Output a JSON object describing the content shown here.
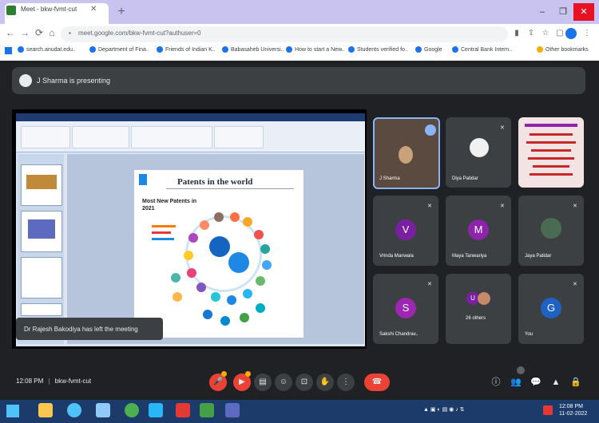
{
  "browser": {
    "tab_title": "Meet - bkw-fvmt-cut",
    "url": "meet.google.com/bkw-fvmt-cut?authuser=0",
    "bookmarks": [
      "search.anudat.edu..",
      "Department of Fina..",
      "Friends of Indian K..",
      "Babasaheb Universi..",
      "How to start a New..",
      "Students verified fo..",
      "Google",
      "Central Bank Intern..",
      "Other bookmarks"
    ]
  },
  "meet": {
    "presenting_text": "J Sharma is presenting",
    "slide_title": "Patents in the world",
    "slide_subtitle": "Most New Patents in 2021",
    "toast": "Dr Rajesh Bakodiya has left the meeting",
    "meeting_time": "12:08 PM",
    "meeting_code": "bkw-fvmt-cut",
    "participants": [
      {
        "name": "J Sharma",
        "initial": ""
      },
      {
        "name": "Diya Patidar",
        "initial": ""
      },
      {
        "name": "",
        "initial": ""
      },
      {
        "name": "Vrinda Manwala",
        "initial": "V",
        "color": "#7b1fa2"
      },
      {
        "name": "Maya Tanwariya",
        "initial": "M",
        "color": "#8e24aa"
      },
      {
        "name": "Jaya Patidar",
        "initial": ""
      },
      {
        "name": "Sakshi Chandrav..",
        "initial": "S",
        "color": "#9c27b0"
      },
      {
        "name": "26 others",
        "initial": "U"
      },
      {
        "name": "You",
        "initial": "G",
        "color": "#1e63c4"
      }
    ]
  },
  "taskbar": {
    "time": "12:08 PM",
    "date": "11-02-2022"
  }
}
